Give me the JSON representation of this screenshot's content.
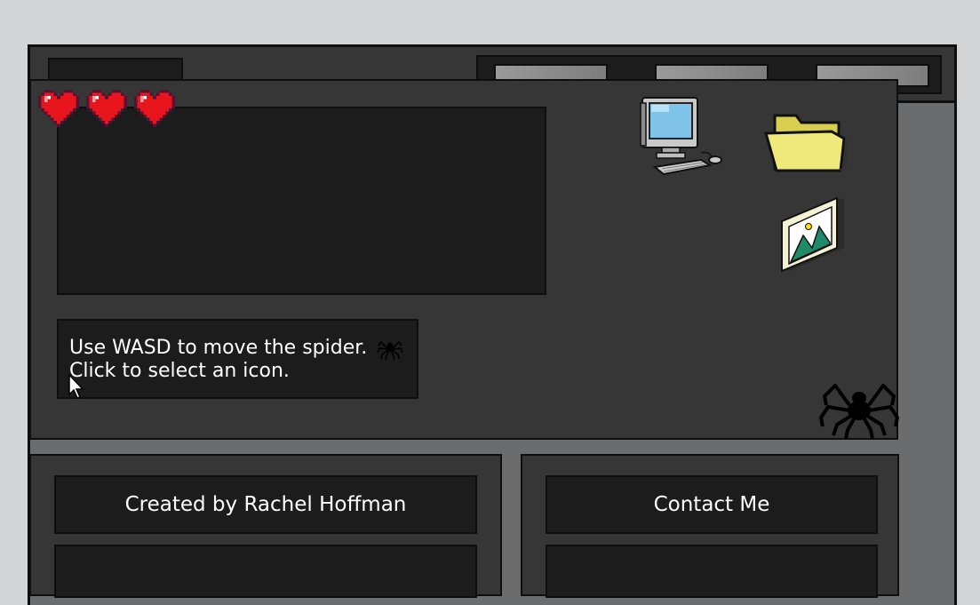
{
  "game": {
    "lives": 3,
    "instructions": {
      "line1": "Use WASD to move the spider.",
      "line2": "Click to select an icon."
    }
  },
  "desktop_icons": [
    "computer-icon",
    "folder-icon",
    "image-icon"
  ],
  "footer": {
    "credit_label": "Created by Rachel Hoffman",
    "contact_label": "Contact Me"
  },
  "colors": {
    "background": "#d3d4d6",
    "window": "#6b6c6e",
    "panel": "#363636",
    "box": "#1c1c1c",
    "heart": "#e8161c",
    "folder": "#efe87a"
  }
}
